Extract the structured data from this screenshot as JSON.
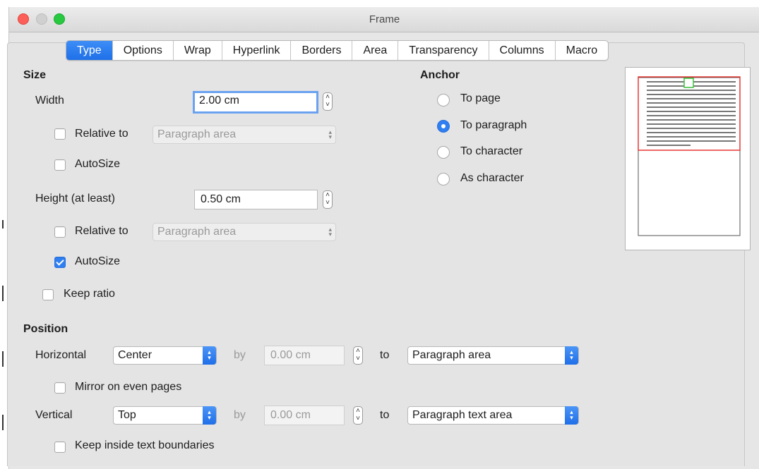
{
  "window": {
    "title": "Frame"
  },
  "tabs": [
    "Type",
    "Options",
    "Wrap",
    "Hyperlink",
    "Borders",
    "Area",
    "Transparency",
    "Columns",
    "Macro"
  ],
  "size": {
    "heading": "Size",
    "width": {
      "label": "Width",
      "value": "2.00 cm"
    },
    "width_relative": {
      "label": "Relative to",
      "checked": false,
      "select": "Paragraph area"
    },
    "width_autosize": {
      "label": "AutoSize",
      "checked": false
    },
    "height": {
      "label": "Height (at least)",
      "value": "0.50 cm"
    },
    "height_relative": {
      "label": "Relative to",
      "checked": false,
      "select": "Paragraph area"
    },
    "height_autosize": {
      "label": "AutoSize",
      "checked": true
    },
    "keep_ratio": {
      "label": "Keep ratio",
      "checked": false
    }
  },
  "anchor": {
    "heading": "Anchor",
    "options": [
      "To page",
      "To paragraph",
      "To character",
      "As character"
    ],
    "selected": "To paragraph"
  },
  "position": {
    "heading": "Position",
    "horizontal": {
      "label": "Horizontal",
      "value": "Center",
      "by_label": "by",
      "by_value": "0.00 cm",
      "to_label": "to",
      "to_value": "Paragraph area"
    },
    "mirror": {
      "label": "Mirror on even pages",
      "checked": false
    },
    "vertical": {
      "label": "Vertical",
      "value": "Top",
      "by_label": "by",
      "by_value": "0.00 cm",
      "to_label": "to",
      "to_value": "Paragraph text area"
    },
    "keep_inside": {
      "label": "Keep inside text boundaries",
      "checked": false
    }
  },
  "colors": {
    "accent": "#2f7ff3",
    "close": "#fc5f57",
    "preview_frame": "#e53935",
    "preview_anchor": "#3cc43c"
  }
}
